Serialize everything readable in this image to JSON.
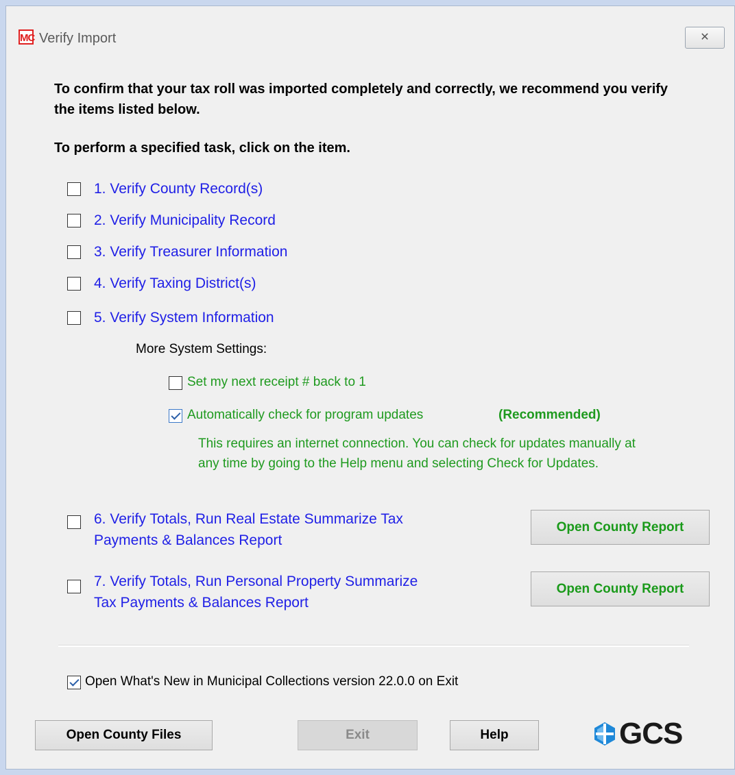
{
  "window": {
    "title": "Verify Import",
    "app_icon_text": "MC",
    "close_symbol": "✕"
  },
  "intro": "To confirm that your tax roll was imported completely and correctly, we recommend you verify the items listed below.",
  "task_hint": "To perform a specified task, click on the item.",
  "items": [
    {
      "label": "1.  Verify County Record(s)",
      "checked": false
    },
    {
      "label": "2.  Verify Municipality Record",
      "checked": false
    },
    {
      "label": "3.  Verify Treasurer Information",
      "checked": false
    },
    {
      "label": "4.  Verify Taxing District(s)",
      "checked": false
    },
    {
      "label": "5.  Verify System Information",
      "checked": false
    }
  ],
  "more_settings": {
    "heading": "More System Settings:",
    "receipt_label": "Set my next receipt # back to 1",
    "receipt_checked": false,
    "updates_label": "Automatically check for program updates",
    "updates_recommended": "(Recommended)",
    "updates_checked": true,
    "updates_note": "This requires an internet connection.  You can check for updates manually at any time by going to the Help menu and selecting Check for Updates."
  },
  "report_items": [
    {
      "line1": "6.  Verify Totals, Run Real Estate Summarize Tax",
      "line2": "Payments & Balances Report",
      "checked": false,
      "button": "Open County Report"
    },
    {
      "line1": "7.  Verify Totals, Run Personal Property Summarize",
      "line2": "Tax Payments & Balances Report",
      "checked": false,
      "button": "Open County Report"
    }
  ],
  "whats_new": {
    "label": "Open What's New in Municipal Collections version 22.0.0 on Exit",
    "checked": true
  },
  "footer": {
    "open_files": "Open County Files",
    "exit": "Exit",
    "help": "Help",
    "logo": "GCS"
  },
  "colors": {
    "link_blue": "#2020e6",
    "green": "#1f9a1f",
    "logo_blue": "#1e88d8"
  }
}
